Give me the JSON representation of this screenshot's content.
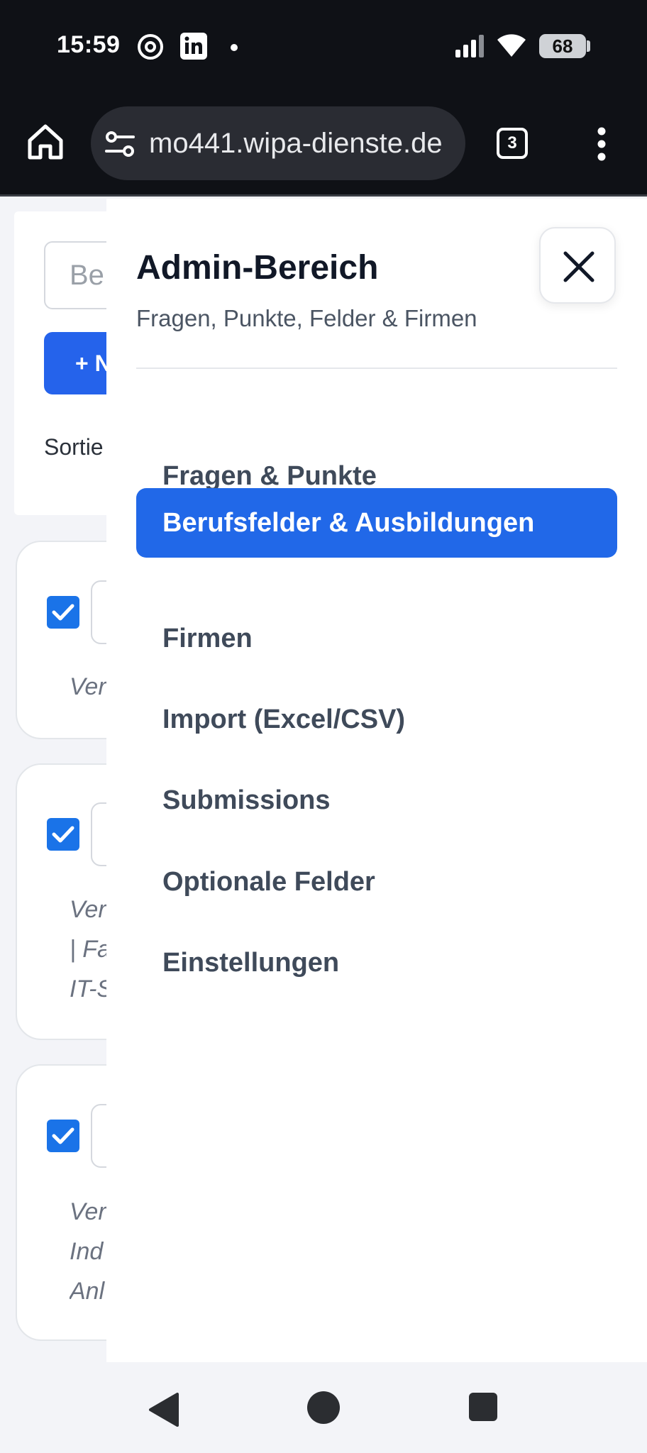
{
  "status_bar": {
    "time": "15:59",
    "battery": "68",
    "icons": [
      "threads-icon",
      "linkedin-icon",
      "notification-dot-icon",
      "signal-icon",
      "wifi-icon",
      "battery-icon"
    ]
  },
  "browser": {
    "url": "mo441.wipa-dienste.de",
    "tab_count": "3"
  },
  "background_page": {
    "search_placeholder": "Be",
    "new_button_label": "+ N",
    "sort_label": "Sortie",
    "cards": [
      {
        "note_lines": [
          "Ver"
        ]
      },
      {
        "note_lines": [
          "Ver",
          "| Fa",
          "IT-S"
        ]
      },
      {
        "note_lines": [
          "Ver",
          "Ind",
          "Anl"
        ]
      }
    ]
  },
  "drawer": {
    "title": "Admin-Bereich",
    "subtitle": "Fragen, Punkte, Felder & Firmen",
    "items": [
      {
        "label": "Fragen & Punkte",
        "active": false
      },
      {
        "label": "Berufsfelder & Ausbildungen",
        "active": true
      },
      {
        "label": "Firmen",
        "active": false
      },
      {
        "label": "Import (Excel/CSV)",
        "active": false
      },
      {
        "label": "Submissions",
        "active": false
      },
      {
        "label": "Optionale Felder",
        "active": false
      },
      {
        "label": "Einstellungen",
        "active": false
      }
    ]
  },
  "colors": {
    "accent": "#2168e8",
    "checkbox": "#1a73e8",
    "status_bar_bg": "#0f1116"
  }
}
